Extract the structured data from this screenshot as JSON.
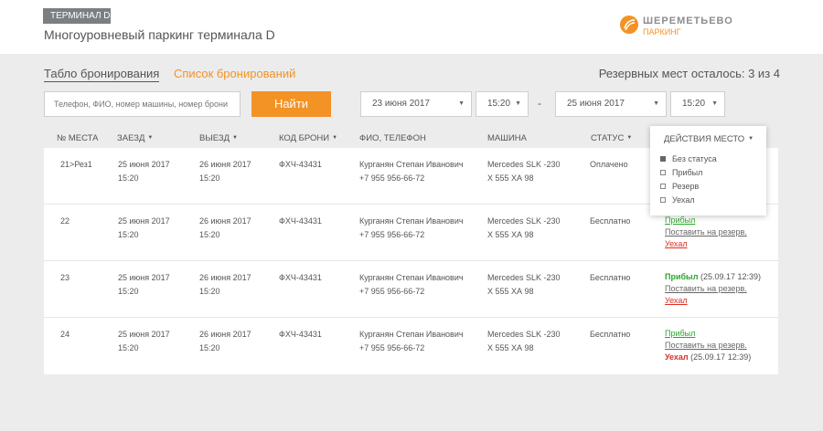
{
  "header": {
    "terminal_badge": "ТЕРМИНАЛ D",
    "title": "Многоуровневый паркинг терминала D",
    "logo_name": "ШЕРЕМЕТЬЕВО",
    "logo_sub": "ПАРКИНГ"
  },
  "tabs": {
    "board": "Табло бронирования",
    "list": "Список бронирований"
  },
  "reserve_info": "Резервных мест осталось: 3 из 4",
  "search": {
    "placeholder": "Телефон, ФИО, номер машины, номер брони",
    "button": "Найти"
  },
  "filters": {
    "date_from": "23 июня 2017",
    "time_from": "15:20",
    "dash": "-",
    "date_to": "25 июня 2017",
    "time_to": "15:20",
    "caret": "▼"
  },
  "columns": {
    "num": "№ МЕСТА",
    "in": "ЗАЕЗД",
    "out": "ВЫЕЗД",
    "code": "КОД БРОНИ",
    "fio": "ФИО, ТЕЛЕФОН",
    "car": "МАШИНА",
    "status": "СТАТУС",
    "sort_arrow": "▼"
  },
  "rows": [
    {
      "num": "21>Рез1",
      "in_date": "25 июня 2017",
      "in_time": "15:20",
      "out_date": "26 июня 2017",
      "out_time": "15:20",
      "code": "ФХЧ-43431",
      "name": "Курганян Степан Иванович",
      "phone": "+7 955 956-66-72",
      "car_model": "Mercedes SLK -230",
      "car_plate": "Х 555 ХА 98",
      "status": "Оплачено"
    },
    {
      "num": "22",
      "in_date": "25 июня 2017",
      "in_time": "15:20",
      "out_date": "26 июня 2017",
      "out_time": "15:20",
      "code": "ФХЧ-43431",
      "name": "Курганян Степан Иванович",
      "phone": "+7 955 956-66-72",
      "car_model": "Mercedes SLK -230",
      "car_plate": "Х 555 ХА 98",
      "status": "Бесплатно",
      "actions": {
        "arrived": "Прибыл",
        "reserve": "Поставить на резерв.",
        "left": "Уехал"
      }
    },
    {
      "num": "23",
      "in_date": "25 июня 2017",
      "in_time": "15:20",
      "out_date": "26 июня 2017",
      "out_time": "15:20",
      "code": "ФХЧ-43431",
      "name": "Курганян Степан Иванович",
      "phone": "+7 955 956-66-72",
      "car_model": "Mercedes SLK -230",
      "car_plate": "Х 555 ХА 98",
      "status": "Бесплатно",
      "actions": {
        "arrived_done": "Прибыл",
        "arrived_time": " (25.09.17 12:39)",
        "reserve": "Поставить на резерв.",
        "left": "Уехал"
      }
    },
    {
      "num": "24",
      "in_date": "25 июня 2017",
      "in_time": "15:20",
      "out_date": "26 июня 2017",
      "out_time": "15:20",
      "code": "ФХЧ-43431",
      "name": "Курганян Степан Иванович",
      "phone": "+7 955 956-66-72",
      "car_model": "Mercedes SLK -230",
      "car_plate": "Х 555 ХА 98",
      "status": "Бесплатно",
      "actions": {
        "arrived": "Прибыл",
        "reserve": "Поставить на резерв.",
        "left_done": "Уехал",
        "left_time": " (25.09.17 12:39)"
      }
    }
  ],
  "actions_dropdown": {
    "title": "ДЕЙСТВИЯ МЕСТО",
    "options": [
      {
        "label": "Без статуса",
        "checked": true
      },
      {
        "label": "Прибыл",
        "checked": false
      },
      {
        "label": "Резерв",
        "checked": false
      },
      {
        "label": "Уехал",
        "checked": false
      }
    ]
  },
  "colors": {
    "accent": "#f39325",
    "badge": "#7b7f84",
    "green": "#2aa52a",
    "red": "#d93025"
  }
}
